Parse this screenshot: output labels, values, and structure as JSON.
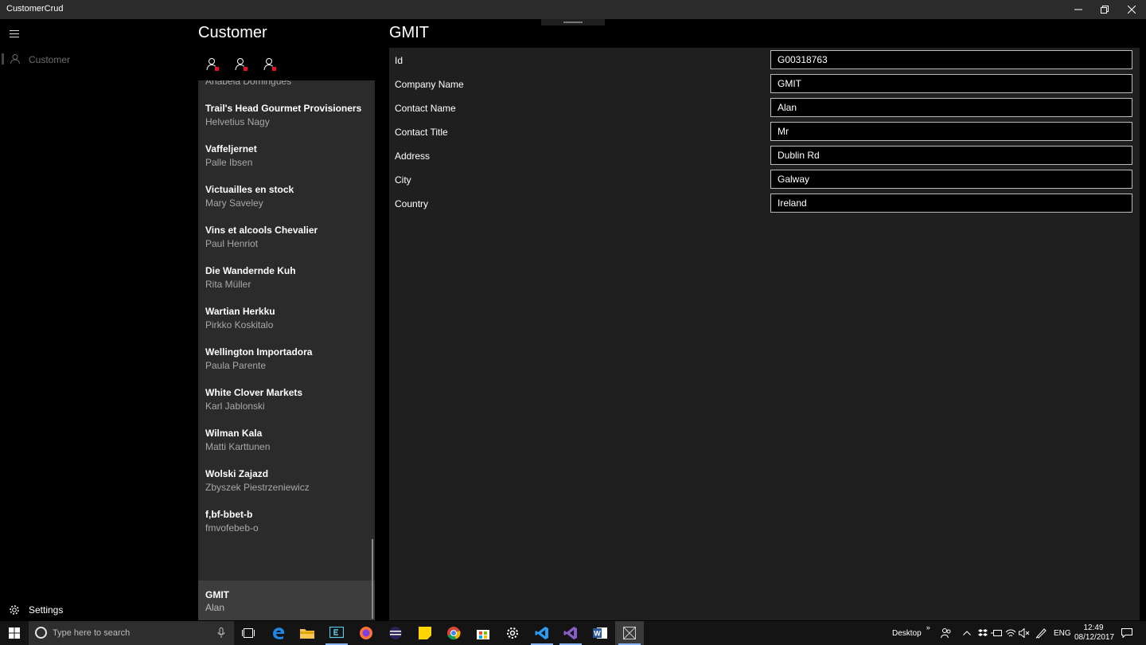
{
  "window": {
    "title": "CustomerCrud"
  },
  "nav": {
    "items": [
      {
        "label": "Customer",
        "icon": "person-icon"
      }
    ],
    "settings_label": "Settings"
  },
  "list": {
    "title": "Customer",
    "commands": [
      "add-person-icon",
      "edit-person-icon",
      "delete-person-icon"
    ],
    "partial_top": {
      "name": "Anabela Domingues"
    },
    "items": [
      {
        "company": "Trail's Head Gourmet Provisioners",
        "contact": "Helvetius Nagy"
      },
      {
        "company": "Vaffeljernet",
        "contact": "Palle Ibsen"
      },
      {
        "company": "Victuailles en stock",
        "contact": "Mary Saveley"
      },
      {
        "company": "Vins et alcools Chevalier",
        "contact": "Paul Henriot"
      },
      {
        "company": "Die Wandernde Kuh",
        "contact": "Rita Müller"
      },
      {
        "company": "Wartian Herkku",
        "contact": "Pirkko Koskitalo"
      },
      {
        "company": "Wellington Importadora",
        "contact": "Paula Parente"
      },
      {
        "company": "White Clover Markets",
        "contact": "Karl Jablonski"
      },
      {
        "company": "Wilman Kala",
        "contact": "Matti Karttunen"
      },
      {
        "company": "Wolski  Zajazd",
        "contact": "Zbyszek Piestrzeniewicz"
      },
      {
        "company": "f,bf-bbet-b",
        "contact": "fmvofebeb-o"
      }
    ],
    "selected": {
      "company": "GMIT",
      "contact": "Alan"
    }
  },
  "detail": {
    "title": "GMIT",
    "fields": [
      {
        "label": "Id",
        "value": "G00318763"
      },
      {
        "label": "Company Name",
        "value": "GMIT"
      },
      {
        "label": "Contact Name",
        "value": "Alan"
      },
      {
        "label": "Contact Title",
        "value": "Mr"
      },
      {
        "label": "Address",
        "value": "Dublin Rd"
      },
      {
        "label": "City",
        "value": "Galway"
      },
      {
        "label": "Country",
        "value": "Ireland"
      }
    ]
  },
  "taskbar": {
    "search_placeholder": "Type here to search",
    "desktop_label": "Desktop",
    "chevron": "»",
    "language": "ENG",
    "time": "12:49",
    "date": "08/12/2017"
  },
  "colors": {
    "background": "#000000",
    "list_panel": "#2b2b2b",
    "detail_panel": "#1f1f1f",
    "selected_item": "#3d3d3d",
    "titlebar": "#2b2b2b"
  }
}
